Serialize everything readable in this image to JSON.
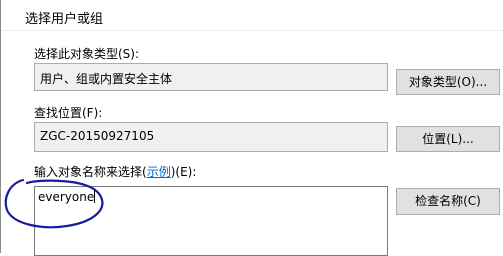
{
  "window": {
    "title": "选择用户或组"
  },
  "object_type": {
    "label": "选择此对象类型(S):",
    "value": "用户、组或内置安全主体",
    "button_label": "对象类型(O)..."
  },
  "location": {
    "label": "查找位置(F):",
    "value": "ZGC-20150927105",
    "button_label": "位置(L)..."
  },
  "names": {
    "label_prefix": "输入对象名称来选择(",
    "examples_link": "示例",
    "label_suffix": ")(E):",
    "value": "everyone",
    "check_button_label": "检查名称(C)"
  },
  "colors": {
    "annotation": "#1a1aa0",
    "link": "#0066cc"
  }
}
